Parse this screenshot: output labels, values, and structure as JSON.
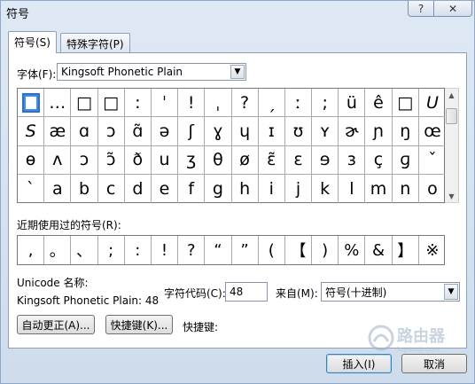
{
  "window": {
    "title": "符号",
    "help_label": "?",
    "close_label": "✕"
  },
  "tabs": [
    {
      "label": "符号(S)",
      "active": true
    },
    {
      "label": "特殊字符(P)",
      "active": false
    }
  ],
  "font": {
    "label": "字体(F):",
    "value": "Kingsoft Phonetic Plain"
  },
  "symbol_grid": [
    [
      "□",
      "…",
      "□",
      "□",
      "꞉",
      "ˈ",
      "!",
      "ˌ",
      "?",
      "ˏ",
      "ː",
      ";",
      "ü",
      "ê",
      "□",
      "U"
    ],
    [
      "S",
      "æ",
      "ɑ",
      "ɔ",
      "ɑ̃",
      "ə",
      "ʃ",
      "ɣ",
      "ɥ",
      "ɪ",
      "ʊ",
      "ʏ",
      "ɚ",
      "ɲ",
      "ŋ",
      "œ"
    ],
    [
      "ɵ",
      "ʌ",
      "ɔ",
      "ɔ̃",
      "ð",
      "u",
      "ʒ",
      "θ",
      "ø",
      "ɛ̃",
      "ɛ",
      "ɘ",
      "ɜ",
      "ç",
      "ɡ",
      "ˇ"
    ],
    [
      "`",
      "a",
      "b",
      "c",
      "d",
      "e",
      "f",
      "g",
      "h",
      "i",
      "j",
      "k",
      "l",
      "m",
      "n",
      "o"
    ]
  ],
  "recent": {
    "label": "近期使用过的符号(R):",
    "symbols": [
      ",",
      "。",
      "、",
      ";",
      ":",
      "!",
      "?",
      "“",
      "”",
      "(",
      "【",
      ")",
      "%",
      "&",
      "】",
      "※"
    ]
  },
  "unicode": {
    "label": "Unicode 名称:",
    "value": "Kingsoft Phonetic Plain: 48"
  },
  "char_code": {
    "label": "字符代码(C):",
    "value": "48"
  },
  "from": {
    "label": "来自(M):",
    "value": "符号(十进制)"
  },
  "buttons": {
    "autocorrect": "自动更正(A)...",
    "shortcut": "快捷键(K)...",
    "shortcut_label": "快捷键:",
    "insert": "插入(I)",
    "cancel": "取消"
  },
  "watermark": {
    "text": "路由器",
    "subtext": "luyouqi.com"
  },
  "colors": {
    "selection": "#2a6fd6",
    "accent": "#3c7fb1"
  }
}
